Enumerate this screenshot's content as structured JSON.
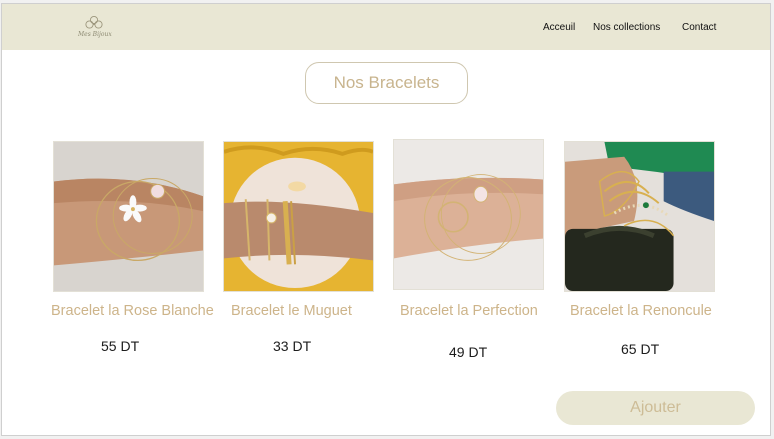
{
  "nav": {
    "logo_text": "Mes Bijoux",
    "links": [
      "Acceuil",
      "Nos collections",
      "Contact"
    ]
  },
  "section_title": "Nos Bracelets",
  "products": [
    {
      "name": "Bracelet la Rose Blanche",
      "price": "55 DT"
    },
    {
      "name": "Bracelet le Muguet",
      "price": "33 DT"
    },
    {
      "name": "Bracelet la Perfection",
      "price": "49 DT"
    },
    {
      "name": "Bracelet la Renoncule",
      "price": "65 DT"
    }
  ],
  "add_button_label": "Ajouter",
  "colors": {
    "navbar": "#e9e7d4",
    "accent_text": "#cdb48a",
    "price_text": "#1c1c1c"
  }
}
